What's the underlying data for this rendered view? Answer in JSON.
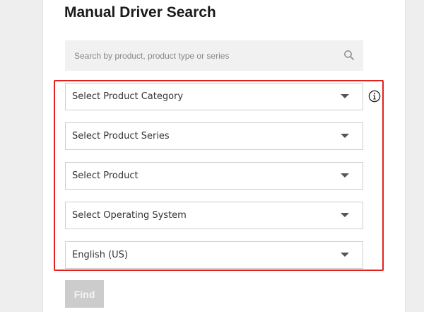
{
  "page": {
    "title": "Manual Driver Search"
  },
  "search": {
    "placeholder": "Search by product, product type or series",
    "icon": "search-icon"
  },
  "filters": {
    "category": {
      "label": "Select Product Category",
      "icon": "chevron-down-icon"
    },
    "series": {
      "label": "Select Product Series",
      "icon": "chevron-down-icon"
    },
    "product": {
      "label": "Select Product",
      "icon": "chevron-down-icon"
    },
    "os": {
      "label": "Select Operating System",
      "icon": "chevron-down-icon"
    },
    "language": {
      "label": "English (US)",
      "icon": "chevron-down-icon"
    },
    "info_icon": "info-icon"
  },
  "actions": {
    "find_label": "Find"
  },
  "colors": {
    "highlight": "#e3201b",
    "button_disabled": "#cccccc",
    "search_bg": "#f1f1f1"
  }
}
